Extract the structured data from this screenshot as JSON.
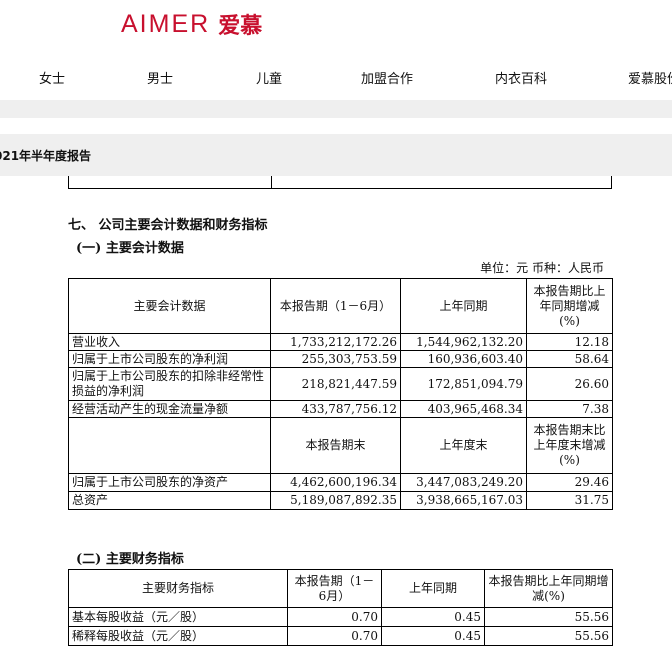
{
  "brand": {
    "logo_en": "AIMER",
    "logo_cn": "爱慕",
    "color": "#c8102e"
  },
  "nav": {
    "items": [
      "女士",
      "男士",
      "儿童",
      "加盟合作",
      "内衣百科",
      "爱慕股份"
    ]
  },
  "report": {
    "title": "021年半年度报告"
  },
  "section": {
    "heading": "七、 公司主要会计数据和财务指标",
    "sub1": "(一) 主要会计数据",
    "unit": "单位：元  币种：人民币",
    "sub2": "(二) 主要财务指标"
  },
  "table1": {
    "header": {
      "c1": "主要会计数据",
      "c2": "本报告期（1－6月）",
      "c3": "上年同期",
      "c4": "本报告期比上年同期增减(%)"
    },
    "rows_a": [
      {
        "label": "营业收入",
        "current": "1,733,212,172.26",
        "prior": "1,544,962,132.20",
        "change": "12.18"
      },
      {
        "label": "归属于上市公司股东的净利润",
        "current": "255,303,753.59",
        "prior": "160,936,603.40",
        "change": "58.64"
      },
      {
        "label": "归属于上市公司股东的扣除非经常性损益的净利润",
        "current": "218,821,447.59",
        "prior": "172,851,094.79",
        "change": "26.60"
      },
      {
        "label": "经营活动产生的现金流量净额",
        "current": "433,787,756.12",
        "prior": "403,965,468.34",
        "change": "7.38"
      }
    ],
    "header2": {
      "c2": "本报告期末",
      "c3": "上年度末",
      "c4": "本报告期末比上年度末增减(%)"
    },
    "rows_b": [
      {
        "label": "归属于上市公司股东的净资产",
        "current": "4,462,600,196.34",
        "prior": "3,447,083,249.20",
        "change": "29.46"
      },
      {
        "label": "总资产",
        "current": "5,189,087,892.35",
        "prior": "3,938,665,167.03",
        "change": "31.75"
      }
    ]
  },
  "table2": {
    "header": {
      "c1": "主要财务指标",
      "c2": "本报告期（1－6月）",
      "c3": "上年同期",
      "c4": "本报告期比上年同期增减(%)"
    },
    "rows": [
      {
        "label": "基本每股收益（元／股）",
        "current": "0.70",
        "prior": "0.45",
        "change": "55.56"
      },
      {
        "label": "稀释每股收益（元／股）",
        "current": "0.70",
        "prior": "0.45",
        "change": "55.56"
      }
    ]
  }
}
